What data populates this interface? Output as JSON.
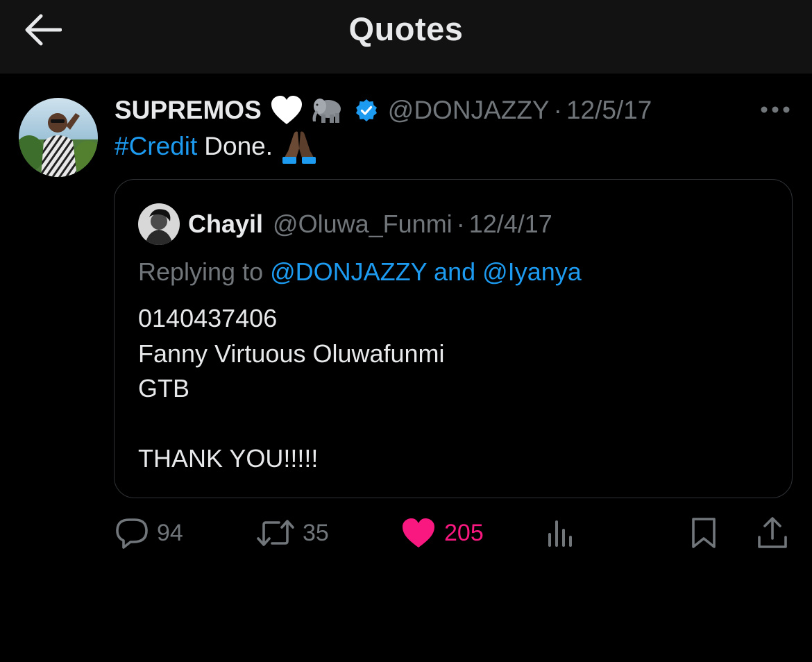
{
  "header": {
    "title": "Quotes",
    "back_icon": "arrow-left-icon"
  },
  "tweet": {
    "display_name": "SUPREMOS",
    "name_emojis": [
      "white-heart-emoji",
      "elephant-emoji"
    ],
    "verified_icon": "verified-badge-icon",
    "handle": "@DONJAZZY",
    "separator": "·",
    "date": "12/5/17",
    "more_icon": "more-dots-icon",
    "hashtag": "#Credit",
    "text": "Done.",
    "text_emoji": "folded-hands-emoji",
    "quoted": {
      "display_name": "Chayil",
      "handle": "@Oluwa_Funmi",
      "separator": "·",
      "date": "12/4/17",
      "replying_prefix": "Replying to",
      "replying_mention_1": "@DONJAZZY",
      "replying_and": "and",
      "replying_mention_2": "@Iyanya",
      "lines": [
        "0140437406",
        "Fanny Virtuous Oluwafunmi",
        "GTB",
        "",
        "THANK YOU!!!!!"
      ]
    },
    "actions": {
      "replies": "94",
      "retweets": "35",
      "likes": "205",
      "reply_icon": "comment-icon",
      "retweet_icon": "retweet-icon",
      "like_icon": "heart-filled-icon",
      "views_icon": "views-chart-icon",
      "bookmark_icon": "bookmark-icon",
      "share_icon": "share-icon"
    }
  },
  "colors": {
    "background": "#000000",
    "header_bg": "#121212",
    "text": "#e7e9ea",
    "muted": "#71767b",
    "link": "#1d9bf0",
    "like": "#f91880",
    "border": "#2f3336"
  }
}
